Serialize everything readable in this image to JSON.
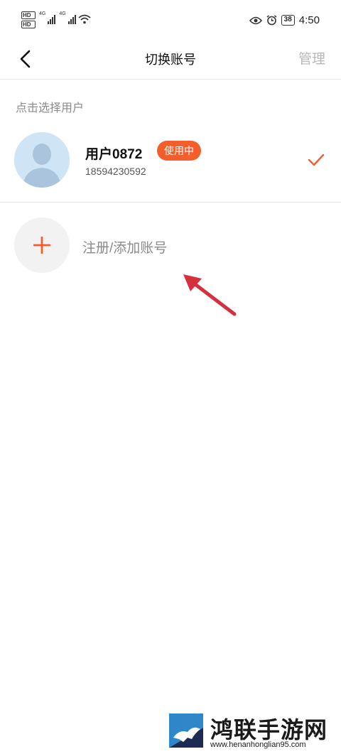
{
  "status_bar": {
    "hd1": "HD",
    "hd2": "HD",
    "net1": "4G",
    "net2": "4G",
    "battery": "38",
    "time": "4:50"
  },
  "header": {
    "title": "切换账号",
    "manage_label": "管理"
  },
  "section_label": "点击选择用户",
  "account": {
    "name": "用户0872",
    "badge": "使用中",
    "phone": "18594230592"
  },
  "add_account": {
    "label": "注册/添加账号"
  },
  "watermark": {
    "name": "鸿联手游网",
    "url": "www.henanhonglian95.com"
  },
  "colors": {
    "accent": "#f25f2c",
    "annotation": "#d6303f"
  }
}
